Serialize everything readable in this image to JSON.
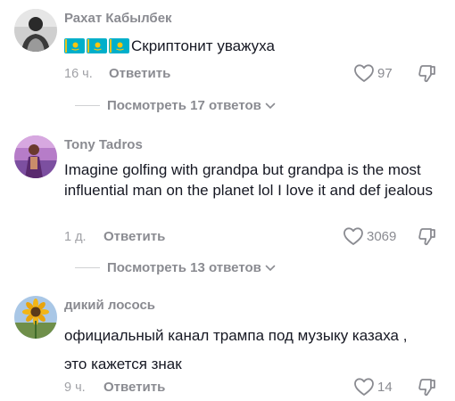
{
  "comments": [
    {
      "author": "Рахат Кабылбек",
      "text": "Скриптонит уважуха",
      "flags": [
        "kazakhstan-flag",
        "kazakhstan-flag",
        "kazakhstan-flag"
      ],
      "time": "16 ч.",
      "reply_label": "Ответить",
      "likes": "97",
      "view_replies": "Посмотреть 17 ответов"
    },
    {
      "author": "Tony Tadros",
      "text": "Imagine golfing with grandpa but grandpa is the most influential man on the planet lol I love it and def jealous",
      "time": "1 д.",
      "reply_label": "Ответить",
      "likes": "3069",
      "view_replies": "Посмотреть 13 ответов"
    },
    {
      "author": "дикий лосось",
      "text": "официальный канал трампа под музыку казаха , это кажется знак",
      "time": "9 ч.",
      "reply_label": "Ответить",
      "likes": "14"
    }
  ],
  "colors": {
    "primary_text": "#161823",
    "secondary_text": "#8a8b91",
    "flag_blue": "#00afca",
    "flag_gold": "#fec50c"
  },
  "icons": {
    "like": "heart-outline-icon",
    "dislike": "thumbs-down-outline-icon",
    "expand": "chevron-down-icon"
  }
}
